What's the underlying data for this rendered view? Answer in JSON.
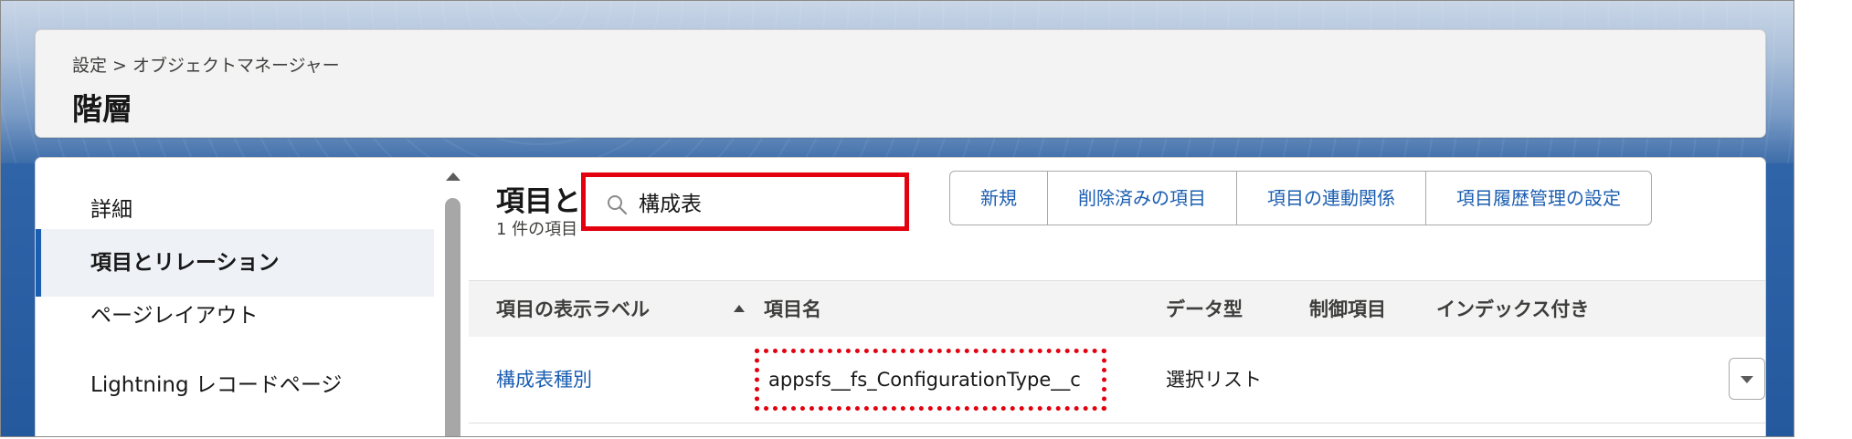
{
  "header": {
    "breadcrumb": "設定 > オブジェクトマネージャー",
    "title": "階層"
  },
  "sidebar": {
    "items": [
      {
        "label": "詳細"
      },
      {
        "label": "項目とリレーション",
        "active": true
      },
      {
        "label": "ページレイアウト"
      },
      {
        "label": "Lightning レコードページ"
      }
    ]
  },
  "content": {
    "section_title": "項目と",
    "item_count": "1 件の項目"
  },
  "search": {
    "value": "構成表",
    "icon": "search-icon"
  },
  "toolbar": {
    "buttons": [
      "新規",
      "削除済みの項目",
      "項目の連動関係",
      "項目履歴管理の設定"
    ]
  },
  "table": {
    "columns": [
      "項目の表示ラベル",
      "項目名",
      "データ型",
      "制御項目",
      "インデックス付き"
    ],
    "sort": {
      "column": "項目の表示ラベル",
      "direction": "ascending"
    },
    "rows": [
      {
        "label": "構成表種別",
        "api_name": "appsfs__fs_ConfigurationType__c",
        "data_type": "選択リスト",
        "controlling_field": "",
        "indexed": ""
      }
    ]
  },
  "colors": {
    "accent": "#1b5eb1",
    "highlight": "#e3000f"
  }
}
